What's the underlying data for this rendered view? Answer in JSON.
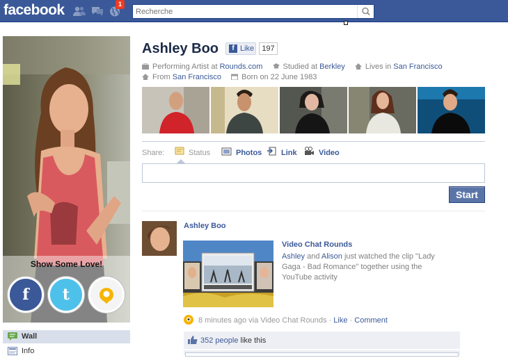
{
  "header": {
    "logo": "facebook",
    "notification_count": "1",
    "search_placeholder": "Recherche"
  },
  "sidebar": {
    "promo_title": "Show Some Love!",
    "social_icons": [
      {
        "name": "facebook-icon",
        "glyph": "f",
        "color": "#3b5998"
      },
      {
        "name": "twitter-icon",
        "glyph": "t",
        "color": "#4ec1ea"
      },
      {
        "name": "rounds-icon",
        "glyph": "",
        "color": "#f6b500"
      }
    ],
    "nav_items": [
      {
        "label": "Wall",
        "icon": "wall-icon",
        "active": true
      },
      {
        "label": "Info",
        "icon": "info-icon",
        "active": false
      }
    ]
  },
  "profile": {
    "name": "Ashley Boo",
    "like_label": "Like",
    "like_count": "197",
    "work_prefix": "Performing Artist at",
    "work_link": "Rounds.com",
    "study_prefix": "Studied at",
    "study_link": "Berkley",
    "lives_prefix": "Lives in",
    "lives_link": "San Francisco",
    "from_prefix": "From",
    "from_link": "San Francisco",
    "born": "Born on 22 June 1983"
  },
  "share": {
    "label": "Share:",
    "items": [
      "Status",
      "Photos",
      "Link",
      "Video"
    ],
    "button": "Start"
  },
  "story": {
    "author": "Ashley Boo",
    "attachment_title": "Video Chat Rounds",
    "actor1": "Ashley",
    "conj": "and",
    "actor2": "Alison",
    "desc_rest": "just watched the clip \"Lady Gaga - Bad Romance\" together using the YouTube activity",
    "time": "8 minutes ago via Video Chat Rounds",
    "sep": "·",
    "like_link": "Like",
    "comment_link": "Comment",
    "likes_count_link": "352 people",
    "likes_suffix": "like this"
  },
  "colors": {
    "brand_blue": "#3b5998",
    "badge_red": "#f03d25",
    "panel_bg": "#edeff4"
  }
}
